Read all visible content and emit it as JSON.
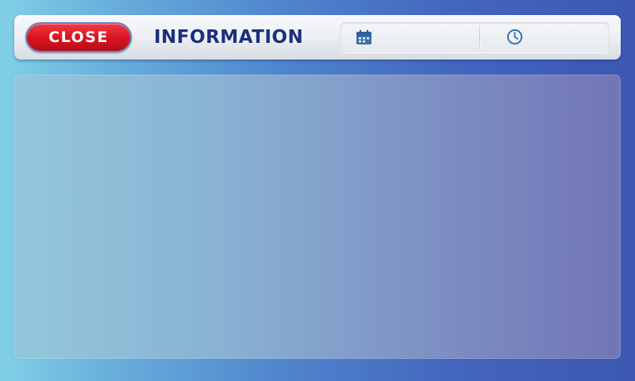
{
  "header": {
    "close_label": "CLOSE",
    "title": "INFORMATION"
  },
  "info_bar": {
    "date_icon": "calendar-icon",
    "date_value": "",
    "time_icon": "clock-icon",
    "time_value": ""
  },
  "colors": {
    "close_button": "#d8141f",
    "title_text": "#1b2f7c",
    "icon": "#3a6fb0"
  },
  "content": {}
}
